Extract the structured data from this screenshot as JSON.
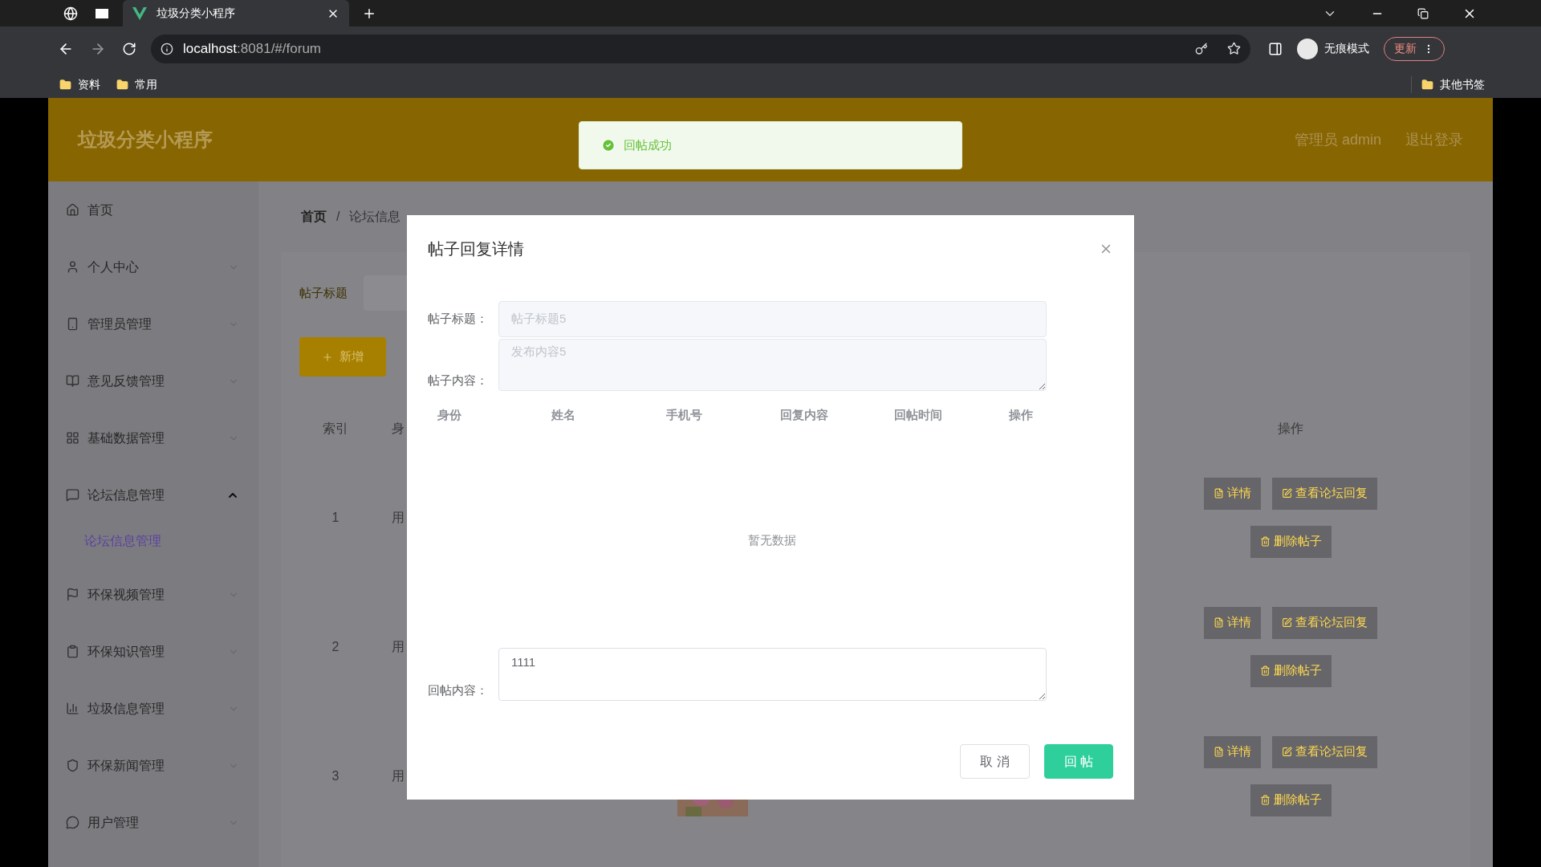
{
  "browser": {
    "tab_title": "垃圾分类小程序",
    "url_host": "localhost",
    "url_rest": ":8081/#/forum",
    "incognito": "无痕模式",
    "update": "更新",
    "bookmarks": [
      "资料",
      "常用"
    ],
    "other_bookmarks": "其他书签"
  },
  "header": {
    "app_title": "垃圾分类小程序",
    "user": "管理员 admin",
    "logout": "退出登录"
  },
  "toast": {
    "message": "回帖成功"
  },
  "sidebar": {
    "items": [
      {
        "kind": "link",
        "label": "首页"
      },
      {
        "kind": "menu",
        "label": "个人中心",
        "expanded": false
      },
      {
        "kind": "menu",
        "label": "管理员管理",
        "expanded": false
      },
      {
        "kind": "menu",
        "label": "意见反馈管理",
        "expanded": false
      },
      {
        "kind": "menu",
        "label": "基础数据管理",
        "expanded": false
      },
      {
        "kind": "menu",
        "label": "论坛信息管理",
        "expanded": true,
        "children": [
          {
            "label": "论坛信息管理",
            "selected": true
          }
        ]
      },
      {
        "kind": "menu",
        "label": "环保视频管理",
        "expanded": false
      },
      {
        "kind": "menu",
        "label": "环保知识管理",
        "expanded": false
      },
      {
        "kind": "menu",
        "label": "垃圾信息管理",
        "expanded": false
      },
      {
        "kind": "menu",
        "label": "环保新闻管理",
        "expanded": false
      },
      {
        "kind": "menu",
        "label": "用户管理",
        "expanded": false
      }
    ]
  },
  "breadcrumb": [
    "首页",
    "论坛信息"
  ],
  "breadcrumb_separator": "/",
  "search": {
    "label": "帖子标题"
  },
  "add_button": "新增",
  "table": {
    "columns": [
      "索引",
      "身"
    ],
    "action_column": "操作",
    "rows": [
      {
        "index": "1",
        "identity": "用",
        "actions": [
          "详情",
          "查看论坛回复",
          "删除帖子"
        ]
      },
      {
        "index": "2",
        "identity": "用",
        "actions": [
          "详情",
          "查看论坛回复",
          "删除帖子"
        ]
      },
      {
        "index": "3",
        "identity": "用",
        "actions": [
          "详情",
          "查看论坛回复",
          "删除帖子"
        ]
      }
    ]
  },
  "dialog": {
    "title": "帖子回复详情",
    "post_title": {
      "label": "帖子标题：",
      "value": "帖子标题5",
      "disabled": true
    },
    "post_content": {
      "label": "帖子内容：",
      "value": "发布内容5",
      "disabled": true
    },
    "reply_table": {
      "columns": [
        "身份",
        "姓名",
        "手机号",
        "回复内容",
        "回帖时间",
        "操作"
      ],
      "empty_text": "暂无数据"
    },
    "reply_field": {
      "label": "回帖内容：",
      "value": "1111",
      "disabled": false
    },
    "buttons": [
      {
        "label": "取 消",
        "kind": "default"
      },
      {
        "label": "回 帖",
        "kind": "primary"
      }
    ]
  }
}
